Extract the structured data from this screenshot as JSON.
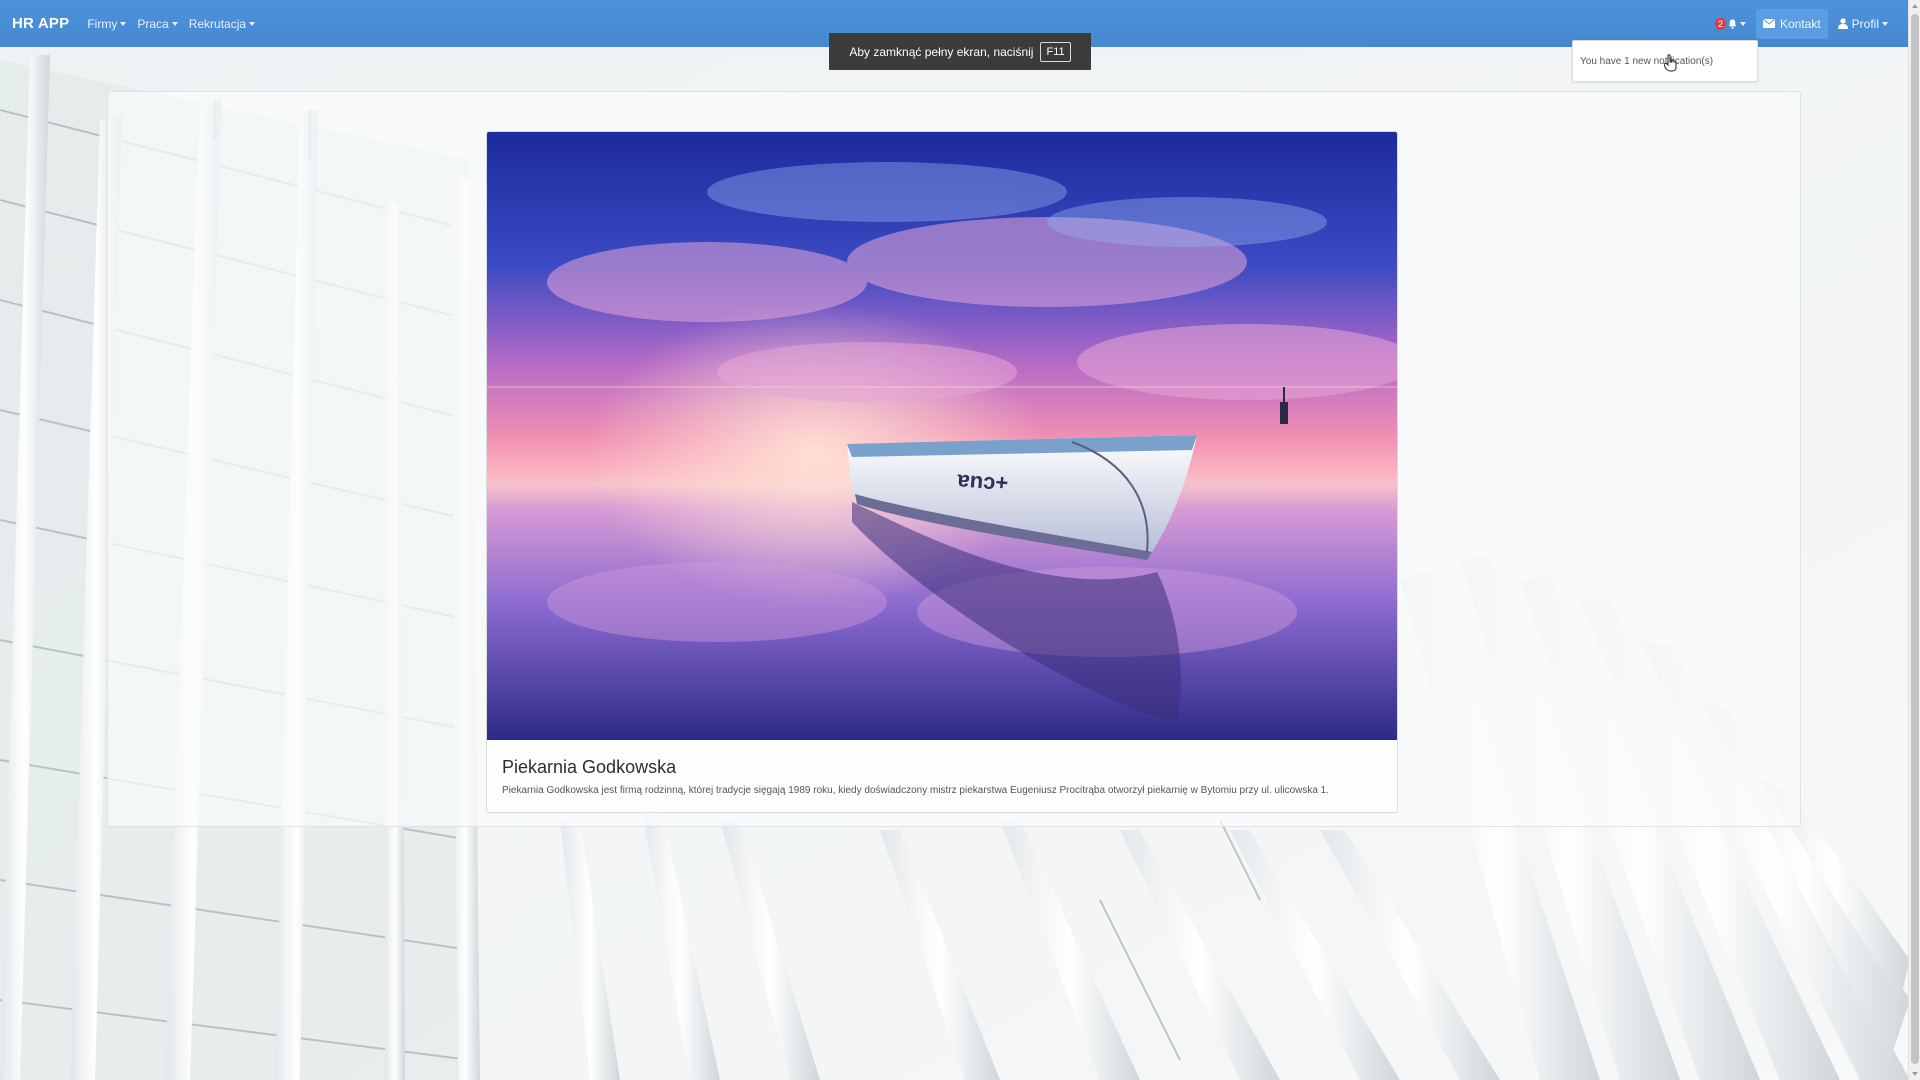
{
  "navbar": {
    "brand": "HR APP",
    "menu": [
      {
        "label": "Firmy"
      },
      {
        "label": "Praca"
      },
      {
        "label": "Rekrutacja"
      }
    ],
    "notification_count": "2",
    "kontakt_label": "Kontakt",
    "profil_label": "Profil"
  },
  "fullscreen_notice": {
    "text": "Aby zamknąć pełny ekran, naciśnij",
    "key": "F11"
  },
  "notifications": {
    "message": "You have 1 new notification(s)"
  },
  "card": {
    "title": "Piekarnia Godkowska",
    "description": "Piekarnia Godkowska jest firmą rodzinną, której tradycje sięgają 1989 roku, kiedy doświadczony mistrz piekarstwa Eugeniusz Procitrąba otworzył piekarnię w Bytomiu przy ul. ulicowska 1."
  },
  "colors": {
    "navbar": "#4a8dd6",
    "badge": "#e23b3b",
    "notice_bg": "#3b3b3b"
  },
  "icons": [
    "bell-icon",
    "envelope-icon",
    "user-icon"
  ]
}
